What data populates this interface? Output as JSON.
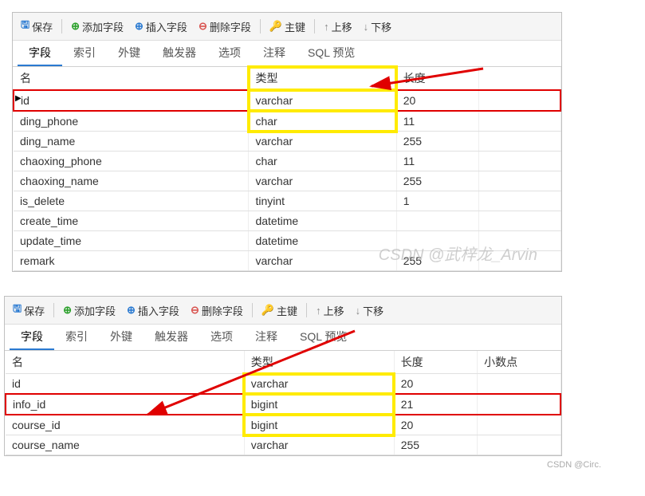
{
  "toolbar": {
    "save": "保存",
    "add": "添加字段",
    "insert": "插入字段",
    "delete": "删除字段",
    "pkey": "主键",
    "up": "上移",
    "down": "下移"
  },
  "tabs": {
    "fields": "字段",
    "indexes": "索引",
    "fkeys": "外键",
    "triggers": "触发器",
    "options": "选项",
    "comments": "注释",
    "sqlpreview": "SQL 预览"
  },
  "headers": {
    "name": "名",
    "type": "类型",
    "length": "长度",
    "decimal": "小数点"
  },
  "table1": [
    {
      "name": "id",
      "type": "varchar",
      "length": "20"
    },
    {
      "name": "ding_phone",
      "type": "char",
      "length": "11"
    },
    {
      "name": "ding_name",
      "type": "varchar",
      "length": "255"
    },
    {
      "name": "chaoxing_phone",
      "type": "char",
      "length": "11"
    },
    {
      "name": "chaoxing_name",
      "type": "varchar",
      "length": "255"
    },
    {
      "name": "is_delete",
      "type": "tinyint",
      "length": "1"
    },
    {
      "name": "create_time",
      "type": "datetime",
      "length": ""
    },
    {
      "name": "update_time",
      "type": "datetime",
      "length": ""
    },
    {
      "name": "remark",
      "type": "varchar",
      "length": "255"
    }
  ],
  "table2": [
    {
      "name": "id",
      "type": "varchar",
      "length": "20",
      "decimal": ""
    },
    {
      "name": "info_id",
      "type": "bigint",
      "length": "21",
      "decimal": ""
    },
    {
      "name": "course_id",
      "type": "bigint",
      "length": "20",
      "decimal": ""
    },
    {
      "name": "course_name",
      "type": "varchar",
      "length": "255",
      "decimal": ""
    }
  ],
  "marks": {
    "watermark": "CSDN @武梓龙_Arvin",
    "corner": "CSDN @Circ."
  }
}
